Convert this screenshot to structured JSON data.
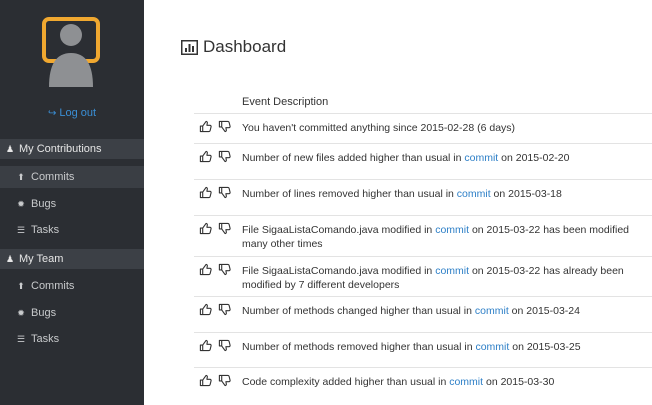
{
  "sidebar": {
    "logout_label": "Log out",
    "sections": [
      {
        "label": "My Contributions",
        "items": [
          {
            "label": "Commits",
            "icon": "upload-icon"
          },
          {
            "label": "Bugs",
            "icon": "bug-icon"
          },
          {
            "label": "Tasks",
            "icon": "tasks-icon"
          }
        ]
      },
      {
        "label": "My Team",
        "items": [
          {
            "label": "Commits",
            "icon": "upload-icon"
          },
          {
            "label": "Bugs",
            "icon": "bug-icon"
          },
          {
            "label": "Tasks",
            "icon": "tasks-icon"
          }
        ]
      }
    ]
  },
  "main": {
    "title": "Dashboard",
    "column_header": "Event Description",
    "events": [
      {
        "pre": "You haven't committed anything since 2015-02-28 (6 days)",
        "link": "",
        "post": ""
      },
      {
        "pre": "Number of new files added higher than usual in ",
        "link": "commit",
        "post": " on 2015-02-20"
      },
      {
        "pre": "Number of lines removed higher than usual in ",
        "link": "commit",
        "post": " on 2015-03-18"
      },
      {
        "pre": "File SigaaListaComando.java modified in ",
        "link": "commit",
        "post": " on 2015-03-22 has been modified many other times"
      },
      {
        "pre": "File SigaaListaComando.java modified in ",
        "link": "commit",
        "post": " on 2015-03-22 has already been modified by 7 different developers"
      },
      {
        "pre": "Number of methods changed higher than usual in ",
        "link": "commit",
        "post": " on 2015-03-24"
      },
      {
        "pre": "Number of methods removed higher than usual in ",
        "link": "commit",
        "post": " on 2015-03-25"
      },
      {
        "pre": "Code complexity added higher than usual in ",
        "link": "commit",
        "post": " on 2015-03-30"
      }
    ]
  },
  "colors": {
    "sidebar_bg": "#2b2e33",
    "section_bg": "#3c4046",
    "link": "#2d7fc7",
    "avatar_frame": "#f0a830"
  }
}
